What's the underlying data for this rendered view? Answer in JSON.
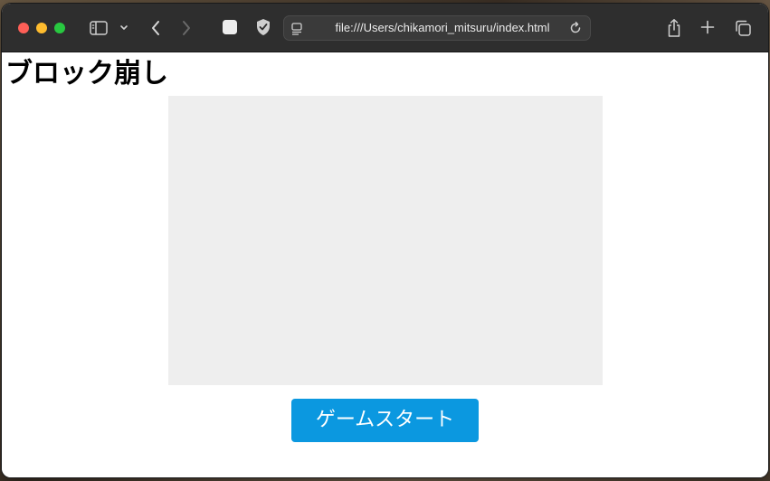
{
  "browser": {
    "address": "file:///Users/chikamori_mitsuru/index.html",
    "icons": {
      "sidebar": "sidebar-icon",
      "chevron": "chevron-down-icon",
      "back": "back-arrow-icon",
      "forward": "forward-arrow-icon",
      "extension": "extension-square-icon",
      "privacy": "shield-check-icon",
      "page": "page-settings-icon",
      "reload": "reload-icon",
      "share": "share-icon",
      "new_tab": "plus-icon",
      "tab_overview": "tab-overview-icon"
    },
    "traffic_lights": {
      "close": "#fe5f57",
      "minimize": "#febc2e",
      "maximize": "#28c840"
    }
  },
  "page": {
    "title": "ブロック崩し",
    "canvas_color": "#eeeeee",
    "start_button": {
      "label": "ゲームスタート",
      "color": "#0b98e0"
    }
  }
}
